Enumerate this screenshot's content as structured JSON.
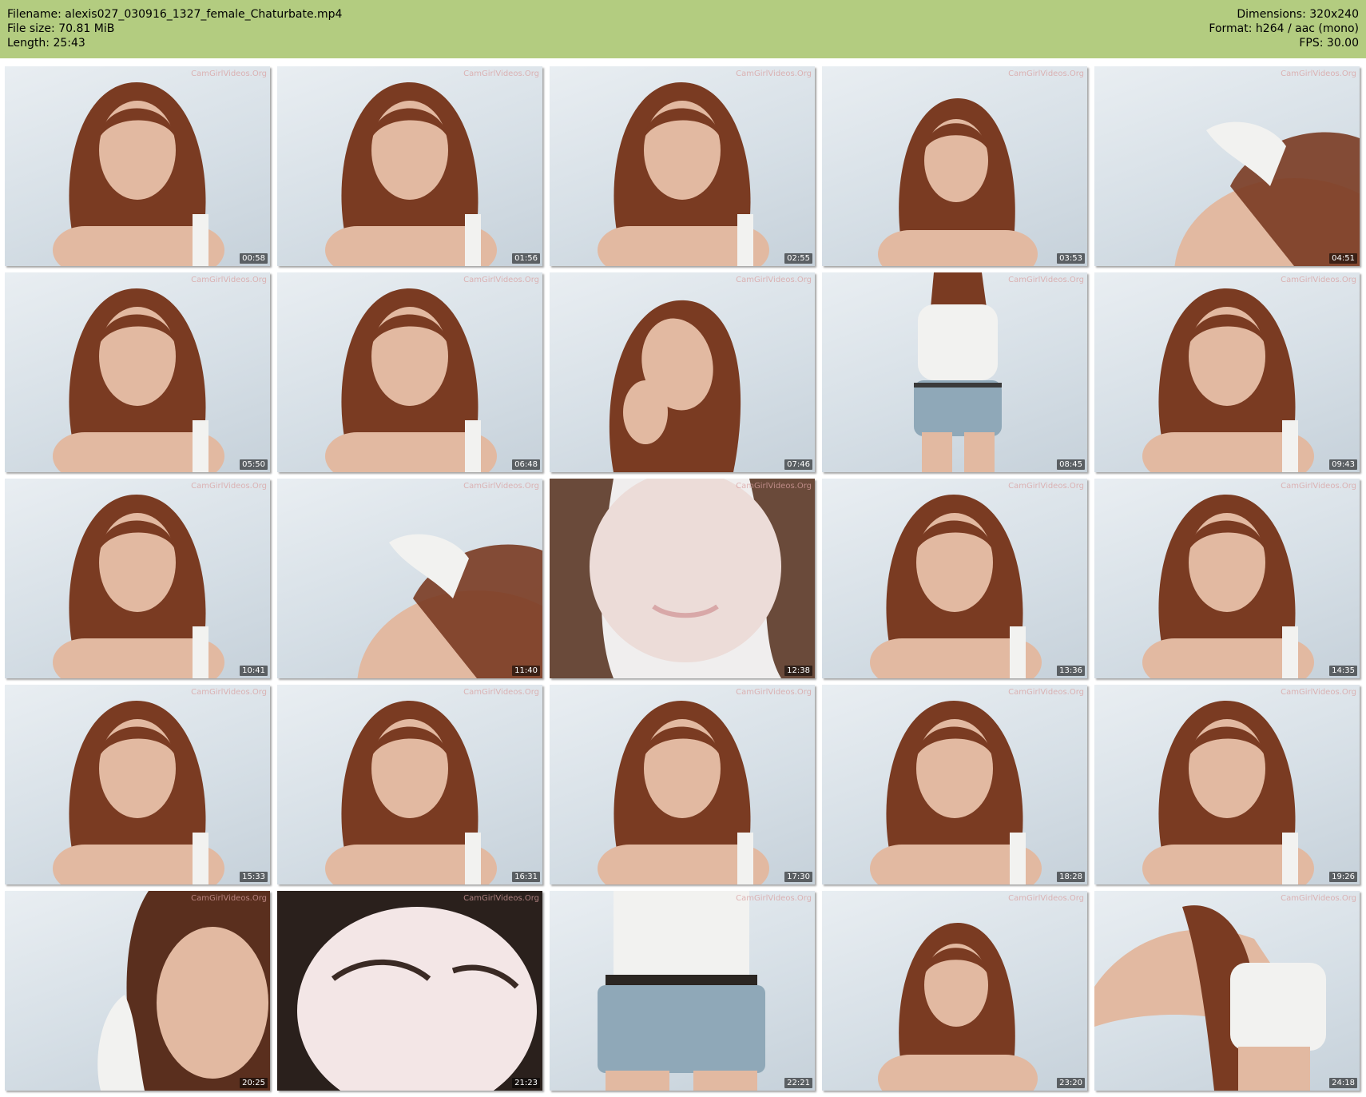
{
  "header": {
    "filename": "Filename: alexis027_030916_1327_female_Chaturbate.mp4",
    "filesize": "File size: 70.81 MiB",
    "length": "Length: 25:43",
    "dimensions": "Dimensions: 320x240",
    "format": "Format: h264 / aac (mono)",
    "fps": "FPS: 30.00"
  },
  "watermark": "CamGirlVideos.Org",
  "colors": {
    "header_bg": "#b3cc80",
    "hair": "#7a3b22",
    "skin": "#e2b9a1",
    "top": "#f2f2f0",
    "shorts": "#8fa8b8"
  },
  "thumbnails": [
    {
      "time": "00:58",
      "scene": "face"
    },
    {
      "time": "01:56",
      "scene": "face"
    },
    {
      "time": "02:55",
      "scene": "face"
    },
    {
      "time": "03:53",
      "scene": "face-far"
    },
    {
      "time": "04:51",
      "scene": "shoulder"
    },
    {
      "time": "05:50",
      "scene": "face"
    },
    {
      "time": "06:48",
      "scene": "face"
    },
    {
      "time": "07:46",
      "scene": "face-tilt"
    },
    {
      "time": "08:45",
      "scene": "standing-back"
    },
    {
      "time": "09:43",
      "scene": "face"
    },
    {
      "time": "10:41",
      "scene": "face"
    },
    {
      "time": "11:40",
      "scene": "shoulder"
    },
    {
      "time": "12:38",
      "scene": "closeup"
    },
    {
      "time": "13:36",
      "scene": "face"
    },
    {
      "time": "14:35",
      "scene": "face"
    },
    {
      "time": "15:33",
      "scene": "face"
    },
    {
      "time": "16:31",
      "scene": "face"
    },
    {
      "time": "17:30",
      "scene": "face"
    },
    {
      "time": "18:28",
      "scene": "face"
    },
    {
      "time": "19:26",
      "scene": "face"
    },
    {
      "time": "20:25",
      "scene": "side"
    },
    {
      "time": "21:23",
      "scene": "closeup-dark"
    },
    {
      "time": "22:21",
      "scene": "torso"
    },
    {
      "time": "23:20",
      "scene": "face-far"
    },
    {
      "time": "24:18",
      "scene": "torso-bent"
    }
  ]
}
